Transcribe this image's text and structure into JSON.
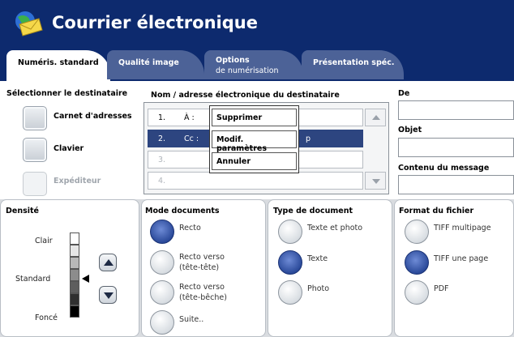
{
  "header": {
    "title": "Courrier électronique",
    "icon": "email-globe-icon"
  },
  "tabs": [
    {
      "label": "Numéris. standard",
      "active": true
    },
    {
      "label": "Qualité image"
    },
    {
      "label": "Options",
      "sub": "de numérisation"
    },
    {
      "label": "Présentation spéc."
    }
  ],
  "recipient": {
    "section_label": "Sélectionner le destinataire",
    "address_book": "Carnet d'adresses",
    "keyboard": "Clavier",
    "sender": "Expéditeur"
  },
  "address_list": {
    "header": "Nom / adresse électronique du destinataire",
    "rows": [
      {
        "num": "1.",
        "type": "À :",
        "value": ""
      },
      {
        "num": "2.",
        "type": "Cc :",
        "value": "p"
      },
      {
        "num": "3.",
        "type": "",
        "value": ""
      },
      {
        "num": "4.",
        "type": "",
        "value": ""
      }
    ]
  },
  "context_menu": {
    "items": [
      "Supprimer",
      "Modif. paramètres",
      "Annuler"
    ]
  },
  "fields": {
    "from_label": "De",
    "subject_label": "Objet",
    "body_label": "Contenu du message"
  },
  "density": {
    "label": "Densité",
    "light": "Clair",
    "standard": "Standard",
    "dark": "Foncé",
    "levels": [
      "#ffffff",
      "#e6e6e6",
      "#b8b8b8",
      "#8c8c8c",
      "#5e5e5e",
      "#303030",
      "#000000"
    ],
    "selected_level": 5
  },
  "doc_mode": {
    "label": "Mode documents",
    "options": [
      {
        "line1": "Recto",
        "line2": "",
        "selected": true
      },
      {
        "line1": "Recto verso",
        "line2": "(tête-tête)"
      },
      {
        "line1": "Recto verso",
        "line2": "(tête-bêche)"
      },
      {
        "line1": "Suite..",
        "line2": ""
      }
    ]
  },
  "doc_type": {
    "label": "Type de document",
    "options": [
      {
        "line1": "Texte et photo",
        "selected": false
      },
      {
        "line1": "Texte",
        "selected": true
      },
      {
        "line1": "Photo",
        "selected": false
      }
    ]
  },
  "file_format": {
    "label": "Format du fichier",
    "options": [
      {
        "line1": "TIFF multipage",
        "selected": false
      },
      {
        "line1": "TIFF une page",
        "selected": true
      },
      {
        "line1": "PDF",
        "selected": false
      }
    ]
  }
}
